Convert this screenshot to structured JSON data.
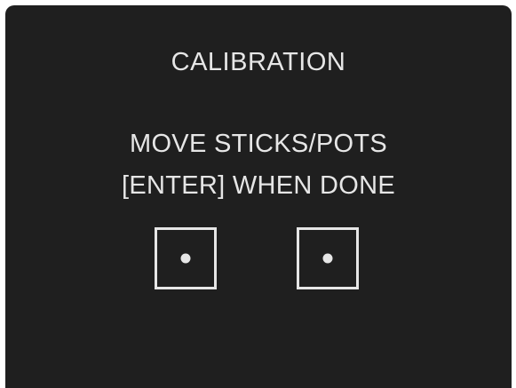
{
  "screen": {
    "title": "CALIBRATION",
    "instruction_line1": "MOVE STICKS/POTS",
    "instruction_line2": "[ENTER] WHEN DONE"
  },
  "sticks": [
    {
      "name": "left-stick",
      "x": 0,
      "y": 0
    },
    {
      "name": "right-stick",
      "x": 0,
      "y": 0
    }
  ],
  "colors": {
    "background": "#1f1f1f",
    "foreground": "#e6e6e6"
  }
}
